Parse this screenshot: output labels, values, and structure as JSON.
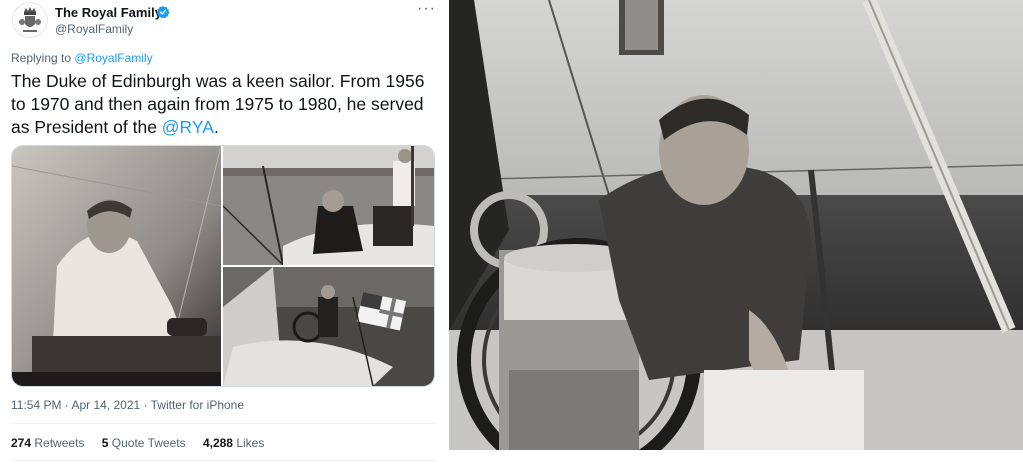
{
  "tweet": {
    "author_name": "The Royal Family",
    "author_handle": "@RoyalFamily",
    "more_label": "···",
    "reply_prefix": "Replying to",
    "reply_to": "@RoyalFamily",
    "text_part1": "The Duke of Edinburgh was a keen sailor. From 1956 to 1970 and then again from 1975 to 1980, he served as President of the ",
    "text_mention": "@RYA",
    "text_part2": ".",
    "timestamp": "11:54 PM · Apr 14, 2021 · Twitter for iPhone",
    "retweets_count": "274",
    "retweets_label": "Retweets",
    "quote_count": "5",
    "quote_label": "Quote Tweets",
    "likes_count": "4,288",
    "likes_label": "Likes"
  },
  "icons": {
    "avatar": "royal-crest-icon",
    "verified": "verified-badge-icon",
    "more": "more-options-icon"
  },
  "colors": {
    "accent": "#1d9bf0",
    "text": "#0f1419",
    "muted": "#536471"
  }
}
